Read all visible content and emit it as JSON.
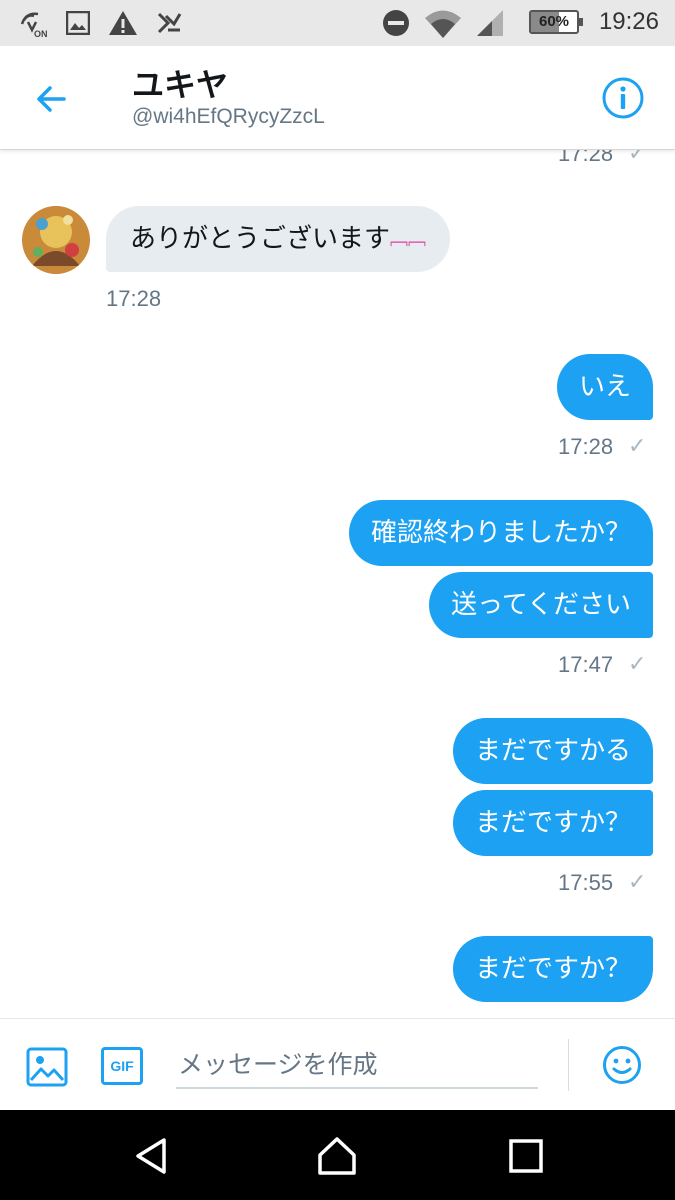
{
  "status_bar": {
    "time": "19:26",
    "battery_percent": "60%",
    "battery_level": 0.6,
    "icons": [
      "nfc-on-icon",
      "image-notification-icon",
      "warning-icon",
      "app-notification-icon",
      "do-not-disturb-icon",
      "wifi-icon",
      "signal-icon",
      "battery-icon"
    ]
  },
  "header": {
    "name": "ユキヤ",
    "handle": "@wi4hEfQRycyZzcL"
  },
  "conversation": {
    "top_clipped_time": "17:28",
    "incoming_message": "ありがとうございます",
    "incoming_emoji": "﹇﹇",
    "incoming_time": "17:28",
    "group1": {
      "messages": [
        "いえ"
      ],
      "time": "17:28"
    },
    "group2": {
      "messages": [
        "確認終わりましたか？",
        "送ってください"
      ],
      "time": "17:47"
    },
    "group3": {
      "messages": [
        "まだですかる",
        "まだですか？"
      ],
      "time": "17:55"
    },
    "group4": {
      "messages": [
        "まだですか？"
      ]
    },
    "read_check": "✓"
  },
  "compose": {
    "placeholder": "メッセージを作成",
    "gif_label": "GIF"
  },
  "colors": {
    "accent": "#1da1f2",
    "incoming_bubble": "#e6ecf0",
    "secondary_text": "#657786"
  }
}
